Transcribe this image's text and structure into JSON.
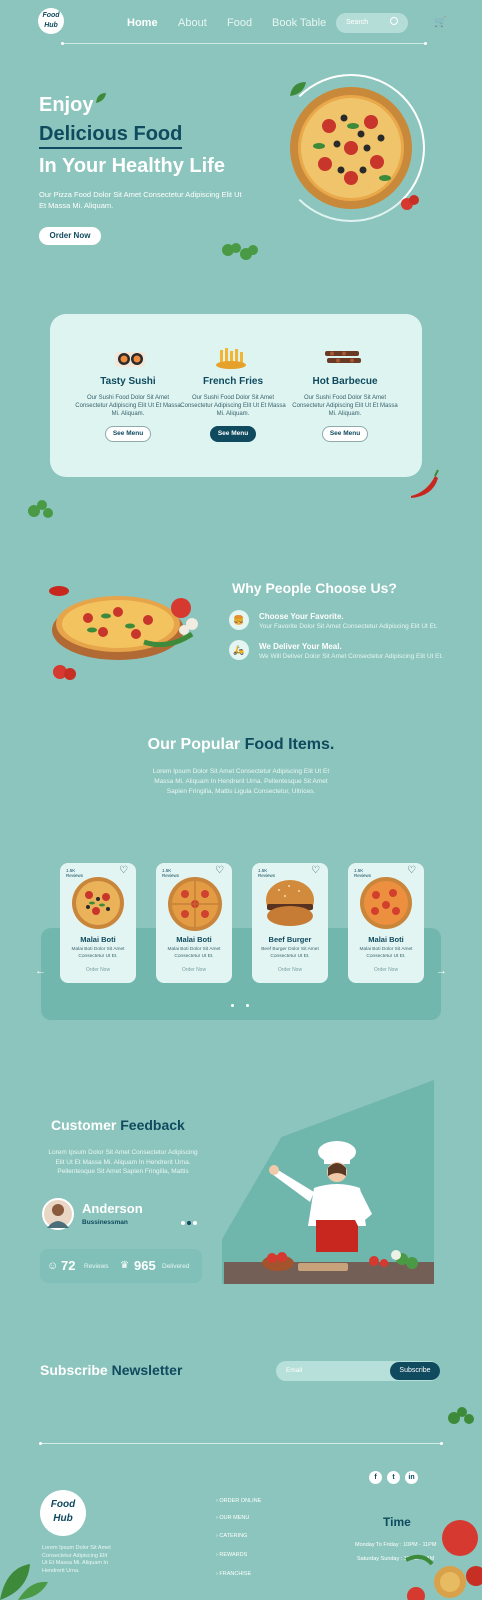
{
  "header": {
    "logo_text": "Food Hub",
    "nav": [
      {
        "label": "Home",
        "active": true
      },
      {
        "label": "About",
        "active": false
      },
      {
        "label": "Food",
        "active": false
      },
      {
        "label": "Book Table",
        "active": false
      }
    ],
    "search_placeholder": "Search"
  },
  "hero": {
    "line1": "Enjoy",
    "line2": "Delicious Food",
    "line3": "In Your Healthy Life",
    "description": "Our Pizza Food Dolor Sit Amet Consectetur Adipiscing Elit Ut Et Massa Mi. Aliquam.",
    "cta": "Order Now"
  },
  "categories": [
    {
      "title": "Tasty Sushi",
      "desc": "Our Sushi Food Dolor Sit Amet Consectetur Adipiscing Elit Ut Et Massa Mi. Aliquam.",
      "button": "See Menu",
      "active": false
    },
    {
      "title": "French Fries",
      "desc": "Our Sushi Food Dolor Sit Amet Consectetur Adipiscing Elit Ut Et Massa Mi. Aliquam.",
      "button": "See Menu",
      "active": true
    },
    {
      "title": "Hot Barbecue",
      "desc": "Our Sushi Food Dolor Sit Amet Consectetur Adipiscing Elit Ut Et Massa Mi. Aliquam.",
      "button": "See Menu",
      "active": false
    }
  ],
  "why": {
    "title": "Why People Choose Us?",
    "items": [
      {
        "title": "Choose Your Favorite.",
        "desc": "Your Favorite Dolor Sit Amet Consectetur Adipiscing Elit Ut Et."
      },
      {
        "title": "We Deliver Your Meal.",
        "desc": "We Will Deliver Dolor Sit Amet Consectetur Adipiscing Elit Ut Et."
      }
    ]
  },
  "popular": {
    "title_a": "Our Popular",
    "title_b": "Food Items.",
    "description": "Lorem Ipsum Dolor Sit Amet Consectetur Adipiscing Elit Ut Et Massa Mi. Aliquam In Hendrerit Urna. Pellentesque Sit Amet Sapien Fringilla, Mattis Ligula Consectetur, Ultrices.",
    "cards": [
      {
        "reviews": "1.5K Reviews",
        "name": "Malai Boti",
        "desc": "Malai Boti Dolor Sit Amet Consectetur Ut Et.",
        "order": "Order Now"
      },
      {
        "reviews": "1.5K Reviews",
        "name": "Malai Boti",
        "desc": "Malai Boti Dolor Sit Amet Consectetur Ut Et.",
        "order": "Order Now"
      },
      {
        "reviews": "1.5K Reviews",
        "name": "Beef Burger",
        "desc": "Beef Burger Dolor Sit Amet Consectetur Ut Et.",
        "order": "Order Now"
      },
      {
        "reviews": "1.5K Reviews",
        "name": "Malai Boti",
        "desc": "Malai Boti Dolor Sit Amet Consectetur Ut Et.",
        "order": "Order Now"
      }
    ]
  },
  "feedback": {
    "title_a": "Customer",
    "title_b": "Feedback",
    "description": "Lorem Ipsum Dolor Sit Amet Consectetur Adipiscing Elit Ut Et Massa Mi. Aliquam In Hendrerit Urna. Pellentesque Sit Amet Sapien Fringilla, Mattis",
    "name": "Anderson",
    "role": "Bussinessman",
    "reviews_num": "72",
    "reviews_label": "Reviews",
    "delivered_num": "965",
    "delivered_label": "Delivered"
  },
  "subscribe": {
    "title_a": "Subscribe",
    "title_b": "Newsletter",
    "placeholder": "Email",
    "button": "Subscribe"
  },
  "footer": {
    "logo_text": "Food Hub",
    "description": "Lorem Ipsum Dolor Sit Amet Consectetur Adipiscing Elit Ut Et Massa Mi. Aliquam In Hendrerit Urna.",
    "social": [
      "f",
      "t",
      "in"
    ],
    "links": [
      "ORDER ONLINE",
      "OUR MENU",
      "CATERING",
      "REWARDS",
      "FRANCHISE"
    ],
    "time_title": "Time",
    "hours": [
      "Monday To Friday : 10PM - 11PM",
      "Saturday Sunday : 12PM - 1AM"
    ]
  },
  "colors": {
    "background": "#8cc5bd",
    "accent_dark": "#0f4a5e",
    "card_light": "#def4f1"
  }
}
